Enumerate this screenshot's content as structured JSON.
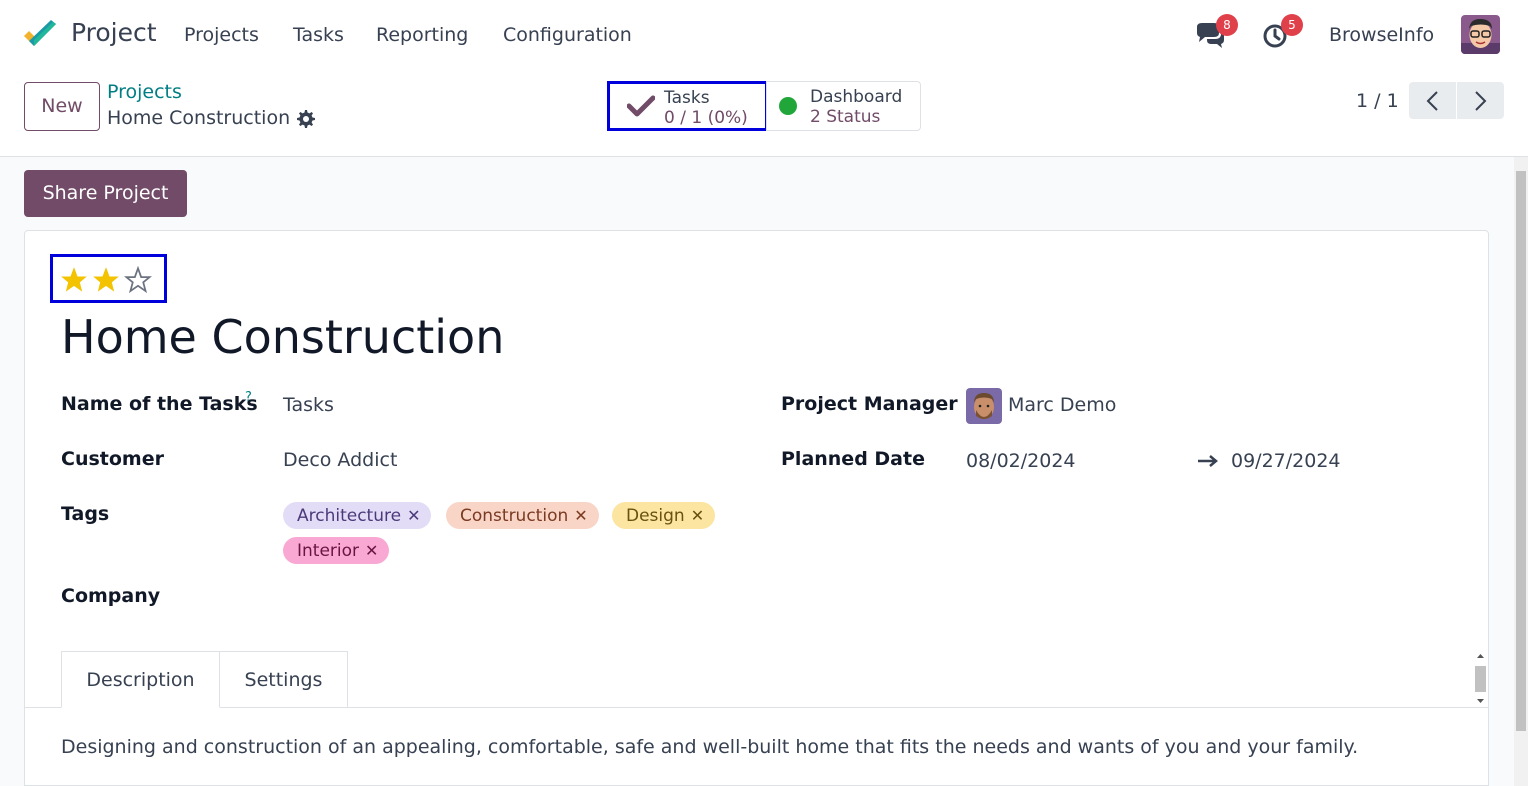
{
  "navbar": {
    "app_title": "Project",
    "menu": [
      "Projects",
      "Tasks",
      "Reporting",
      "Configuration"
    ],
    "messages_count": "8",
    "activities_count": "5",
    "company": "BrowseInfo"
  },
  "control_panel": {
    "new_label": "New",
    "breadcrumb_parent": "Projects",
    "breadcrumb_current": "Home Construction",
    "stat_tasks": {
      "label": "Tasks",
      "value": "0 / 1 (0%)"
    },
    "stat_dashboard": {
      "label": "Dashboard",
      "value": "2 Status"
    },
    "pager": "1 / 1"
  },
  "form": {
    "share_label": "Share Project",
    "priority": {
      "filled": 2,
      "total": 3
    },
    "title": "Home Construction",
    "fields": {
      "task_name_label": "Name of the Tasks",
      "task_name_help": "?",
      "task_name_value": "Tasks",
      "customer_label": "Customer",
      "customer_value": "Deco Addict",
      "tags_label": "Tags",
      "company_label": "Company",
      "manager_label": "Project Manager",
      "manager_value": "Marc Demo",
      "planned_label": "Planned Date",
      "planned_start": "08/02/2024",
      "planned_end": "09/27/2024"
    },
    "tags": [
      {
        "name": "Architecture",
        "bg": "#e3dcf7",
        "fg": "#4b3a7a"
      },
      {
        "name": "Construction",
        "bg": "#f8d5c6",
        "fg": "#7a3a22"
      },
      {
        "name": "Design",
        "bg": "#fbe5a0",
        "fg": "#6a5011"
      },
      {
        "name": "Interior",
        "bg": "#f9a8d4",
        "fg": "#6a1541"
      }
    ],
    "tabs": [
      "Description",
      "Settings"
    ],
    "description": "Designing and construction of an appealing, comfortable, safe and well-built home that fits the needs and wants of you and your family."
  },
  "colors": {
    "brand": "#714b67",
    "link": "#017e84",
    "star": "#f3c300",
    "highlight_box": "#0000dd"
  }
}
